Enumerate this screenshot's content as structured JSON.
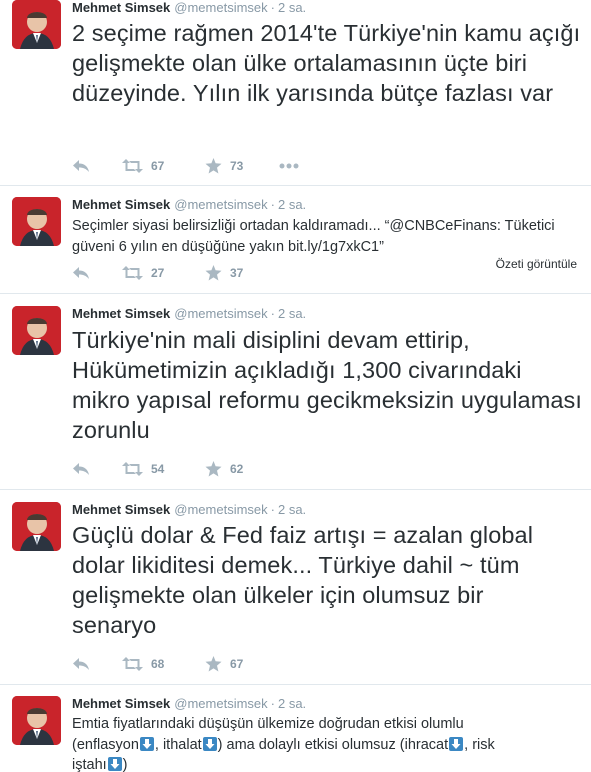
{
  "tweets": [
    {
      "name": "Mehmet Simsek",
      "handle": "@memetsimsek",
      "dot": "·",
      "time": "2 sa.",
      "text": "2 seçime rağmen 2014'te Türkiye'nin kamu açığı gelişmekte olan ülke ortalamasının üçte biri düzeyinde. Yılın ilk yarısında bütçe fazlası var",
      "retweets": "67",
      "favorites": "73"
    },
    {
      "name": "Mehmet Simsek",
      "handle": "@memetsimsek",
      "dot": "·",
      "time": "2 sa.",
      "text": "Seçimler siyasi belirsizliği ortadan kaldıramadı... “@CNBCeFinans: Tüketici güveni 6 yılın en düşüğüne yakın bit.ly/1g7xkC1”",
      "retweets": "27",
      "favorites": "37",
      "summary_link": "Özeti görüntüle"
    },
    {
      "name": "Mehmet Simsek",
      "handle": "@memetsimsek",
      "dot": "·",
      "time": "2 sa.",
      "text": "Türkiye'nin mali disiplini devam ettirip, Hükümetimizin açıkladığı 1,300 civarındaki mikro yapısal reformu gecikmeksizin uygulaması zorunlu",
      "retweets": "54",
      "favorites": "62"
    },
    {
      "name": "Mehmet Simsek",
      "handle": "@memetsimsek",
      "dot": "·",
      "time": "2 sa.",
      "text": "Güçlü dolar & Fed faiz artışı = azalan global dolar likiditesi demek... Türkiye dahil ~ tüm gelişmekte olan ülkeler için olumsuz bir senaryo",
      "retweets": "68",
      "favorites": "67"
    },
    {
      "name": "Mehmet Simsek",
      "handle": "@memetsimsek",
      "dot": "·",
      "time": "2 sa.",
      "text_parts": {
        "p1": "Emtia fiyatlarındaki düşüşün ülkemize doğrudan etkisi olumlu",
        "p2": "(enflasyon",
        "p3": ", ithalat",
        "p4": ") ama dolaylı etkisi olumsuz (ihracat",
        "p5": ", risk",
        "p6": "iştahı",
        "p7": ")"
      }
    }
  ],
  "icons": {
    "reply": "reply-icon",
    "retweet": "retweet-icon",
    "favorite": "star-icon",
    "more": "more-dots-icon",
    "emoji": "down-arrow-emoji-icon"
  },
  "colors": {
    "icon_gray": "#aab8c2",
    "text": "#292f33",
    "muted": "#8899a6",
    "divider": "#e1e8ed",
    "emoji_blue": "#3b88c3",
    "avatar_red": "#c9242b"
  }
}
